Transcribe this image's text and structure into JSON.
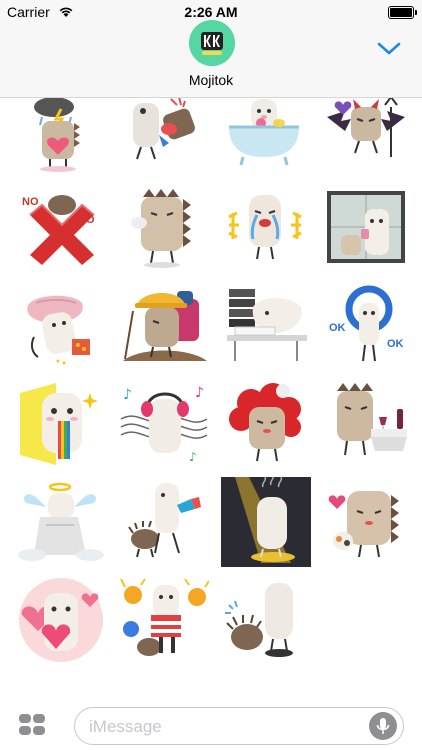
{
  "status_bar": {
    "carrier": "Carrier",
    "time": "2:26 AM",
    "battery_percent": 100
  },
  "header": {
    "app_name": "Mojitok",
    "app_icon": "mojitok-logo",
    "collapse_icon": "chevron-down-icon"
  },
  "stickers": [
    {
      "row": 1,
      "col": 1,
      "name": "hedgehog-rain-cloud-heart"
    },
    {
      "row": 1,
      "col": 2,
      "name": "alpaca-hedgehog-fight"
    },
    {
      "row": 1,
      "col": 3,
      "name": "alpaca-bathtub"
    },
    {
      "row": 1,
      "col": 4,
      "name": "hedgehog-devil-wings"
    },
    {
      "row": 2,
      "col": 1,
      "name": "hedgehog-no-red-x"
    },
    {
      "row": 2,
      "col": 2,
      "name": "hedgehog-sigh"
    },
    {
      "row": 2,
      "col": 3,
      "name": "alpaca-crying"
    },
    {
      "row": 2,
      "col": 4,
      "name": "alpaca-window"
    },
    {
      "row": 3,
      "col": 1,
      "name": "alpaca-pillow-snack"
    },
    {
      "row": 3,
      "col": 2,
      "name": "hedgehog-hiking-backpack"
    },
    {
      "row": 3,
      "col": 3,
      "name": "alpaca-desk-paperwork"
    },
    {
      "row": 3,
      "col": 4,
      "name": "alpaca-ok-ring"
    },
    {
      "row": 4,
      "col": 1,
      "name": "alpaca-rainbow-drool"
    },
    {
      "row": 4,
      "col": 2,
      "name": "alpaca-headphones-music"
    },
    {
      "row": 4,
      "col": 3,
      "name": "hedgehog-red-hair"
    },
    {
      "row": 4,
      "col": 4,
      "name": "hedgehog-wine-table"
    },
    {
      "row": 5,
      "col": 1,
      "name": "alpaca-angel-cloud"
    },
    {
      "row": 5,
      "col": 2,
      "name": "alpaca-hedgehog-hairdryer"
    },
    {
      "row": 5,
      "col": 3,
      "name": "alpaca-spotlight-dark"
    },
    {
      "row": 5,
      "col": 4,
      "name": "hedgehog-heart-cat"
    },
    {
      "row": 6,
      "col": 1,
      "name": "alpaca-pink-heart"
    },
    {
      "row": 6,
      "col": 2,
      "name": "alpaca-hedgehog-cheerleader"
    },
    {
      "row": 6,
      "col": 3,
      "name": "alpaca-hedgehog-sweat"
    }
  ],
  "colors": {
    "accent": "#1e88e5",
    "app_icon_bg": "#55d6a2",
    "header_bg": "#f7f7f7"
  },
  "bottom_bar": {
    "apps_icon": "app-drawer-icon",
    "input_placeholder": "iMessage",
    "mic_icon": "microphone-icon"
  }
}
